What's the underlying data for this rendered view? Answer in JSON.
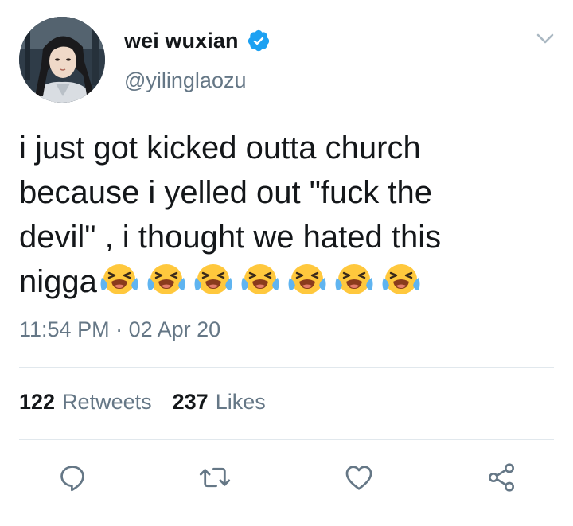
{
  "tweet": {
    "display_name": "wei wuxian",
    "handle": "@yilinglaozu",
    "verified": true,
    "text_lines": [
      "i just got kicked outta church",
      "because i yelled out \"fuck the",
      "devil\" , i thought we hated this",
      "nigga"
    ],
    "emoji_name": "loudly-crying-face-icon",
    "emoji_count": 7,
    "time": "11:54 PM",
    "separator": "·",
    "date": "02 Apr 20"
  },
  "stats": {
    "retweets_count": "122",
    "retweets_label": "Retweets",
    "likes_count": "237",
    "likes_label": "Likes"
  },
  "actions": {
    "icons": [
      "reply-icon",
      "retweet-icon",
      "like-icon",
      "share-icon"
    ]
  },
  "colors": {
    "text": "#14171a",
    "secondary": "#657786",
    "accent": "#1da1f2",
    "divider": "#e1e8ed",
    "emoji_face": "#ffc83d",
    "emoji_mouth": "#8a3b1c",
    "emoji_tears": "#5fb4f0"
  }
}
